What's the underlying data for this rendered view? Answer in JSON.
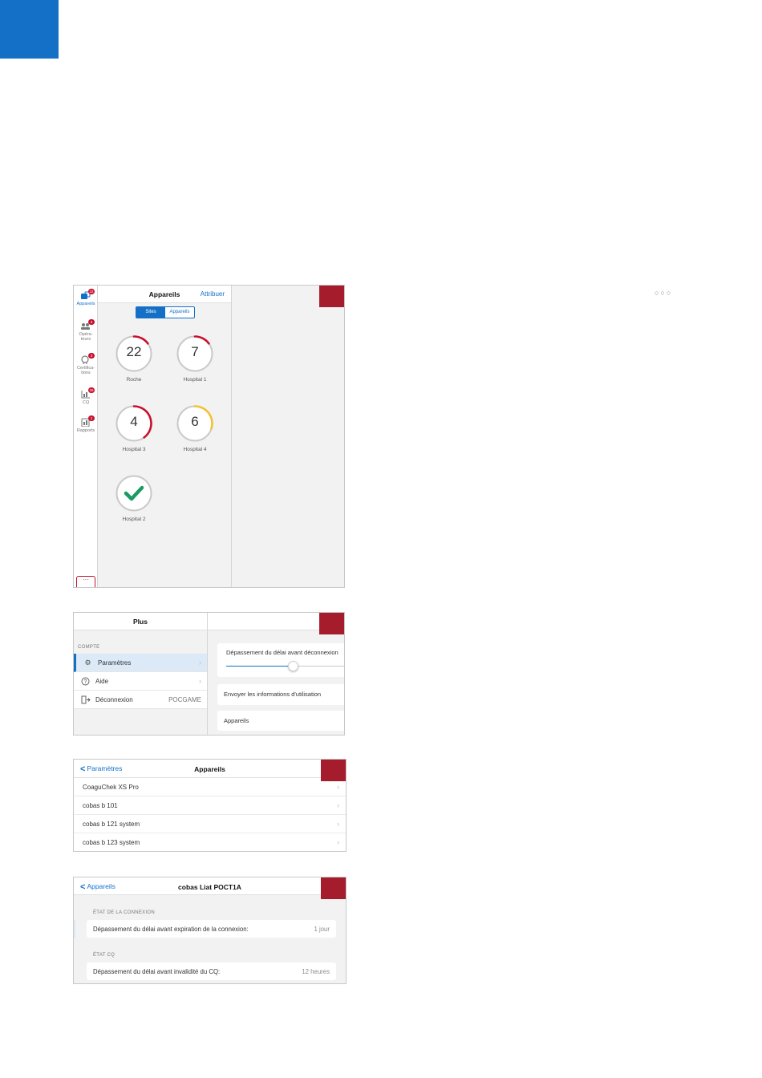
{
  "screen1": {
    "sidebar": [
      {
        "label": "Appareils",
        "badge": "22",
        "active": true
      },
      {
        "label": "Opéra-\nteurs",
        "badge": "3",
        "active": false
      },
      {
        "label": "Certifica-\ntions",
        "badge": "3",
        "active": false
      },
      {
        "label": "CQ",
        "badge": "25",
        "active": false
      },
      {
        "label": "Rapports",
        "badge": "1",
        "active": false
      }
    ],
    "more_label": "···",
    "title": "Appareils",
    "assign": "Attribuer",
    "segments": [
      "Sites",
      "Appareils"
    ],
    "sites": [
      {
        "count": "22",
        "name": "Roche",
        "status": "red",
        "fraction": 0.15
      },
      {
        "count": "7",
        "name": "Hospital 1",
        "status": "red",
        "fraction": 0.15
      },
      {
        "count": "4",
        "name": "Hospital 3",
        "status": "red",
        "fraction": 0.4
      },
      {
        "count": "6",
        "name": "Hospital 4",
        "status": "yellow",
        "fraction": 0.3
      },
      {
        "count": "",
        "name": "Hospital 2",
        "status": "ok",
        "fraction": 0
      }
    ]
  },
  "screen2": {
    "title": "Plus",
    "section": "COMPTE",
    "menu": [
      {
        "icon": "gear-icon",
        "label": "Paramètres",
        "value": ""
      },
      {
        "icon": "help-icon",
        "label": "Aide",
        "value": ""
      },
      {
        "icon": "logout-icon",
        "label": "Déconnexion",
        "value": "POCGAME"
      }
    ],
    "detail": {
      "timeout_label": "Dépassement du délai avant déconnexion",
      "slider_fraction": 0.55,
      "usage_label": "Envoyer les informations d'utilisation",
      "devices_label": "Appareils"
    }
  },
  "screen3": {
    "back": "Paramètres",
    "title": "Appareils",
    "devices": [
      "CoaguChek XS Pro",
      "cobas b 101",
      "cobas b 121 system",
      "cobas b 123 system"
    ]
  },
  "screen4": {
    "back": "Appareils",
    "title": "cobas Liat POCT1A",
    "sections": [
      {
        "header": "ÉTAT DE LA CONNEXION",
        "label": "Dépassement du délai avant expiration de la connexion:",
        "value": "1 jour"
      },
      {
        "header": "ÉTAT CQ",
        "label": "Dépassement du délai avant invalidité du CQ:",
        "value": "12 heures"
      }
    ]
  },
  "colors": {
    "accent": "#1370c6",
    "red": "#c8102e",
    "yellow": "#f2c230",
    "green": "#1a9b62",
    "marker": "#a51d2d"
  }
}
